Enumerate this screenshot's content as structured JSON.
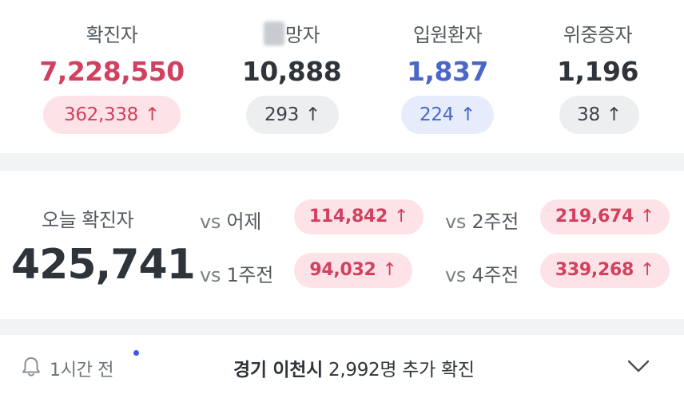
{
  "stats": [
    {
      "label": "확진자",
      "value": "7,228,550",
      "delta": "362,338",
      "color": "#d2405f",
      "pill_bg": "#fde3e7",
      "pill_fg": "#d2405f"
    },
    {
      "label": "망자",
      "value": "10,888",
      "delta": "293",
      "color": "#2f343b",
      "pill_bg": "#eceef0",
      "pill_fg": "#3e434a"
    },
    {
      "label": "입원환자",
      "value": "1,837",
      "delta": "224",
      "color": "#4a66c9",
      "pill_bg": "#e6ecfb",
      "pill_fg": "#4a66c9"
    },
    {
      "label": "위중증자",
      "value": "1,196",
      "delta": "38",
      "color": "#2f343b",
      "pill_bg": "#eceef0",
      "pill_fg": "#3e434a"
    }
  ],
  "arrow_glyph": "↑",
  "today": {
    "label": "오늘 확진자",
    "value": "425,741",
    "comparisons": [
      {
        "vs": "vs",
        "period": "어제",
        "delta": "114,842"
      },
      {
        "vs": "vs",
        "period": "2주전",
        "delta": "219,674"
      },
      {
        "vs": "vs",
        "period": "1주전",
        "delta": "94,032"
      },
      {
        "vs": "vs",
        "period": "4주전",
        "delta": "339,268"
      }
    ]
  },
  "footer": {
    "time": "1시간 전",
    "location": "경기 이천시",
    "message": "2,992명 추가 확진",
    "bell_icon": "bell-icon",
    "expand_icon": "chevron-down-icon"
  }
}
